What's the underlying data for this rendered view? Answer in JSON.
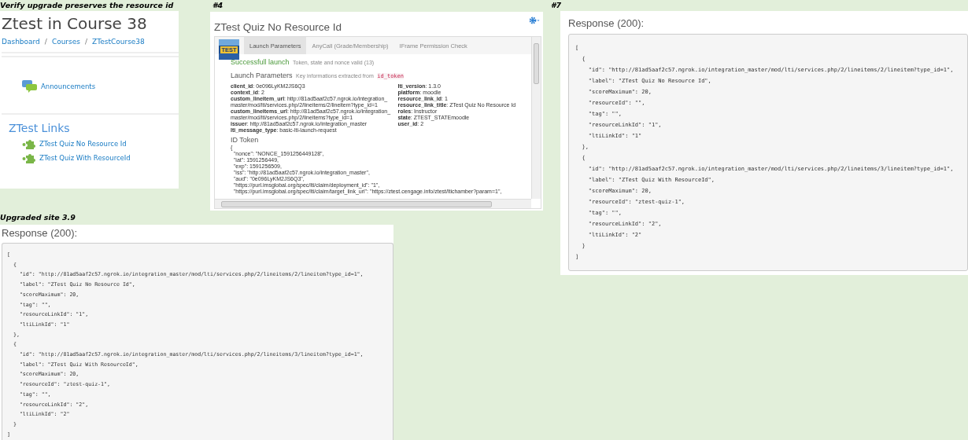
{
  "course_page": {
    "caption": "Verify upgrade preserves the resource id",
    "title": "Ztest in Course 38",
    "breadcrumbs": [
      "Dashboard",
      "Courses",
      "ZTestCourse38"
    ],
    "breadcrumb_separator": "/",
    "activities": [
      {
        "label": "Announcements"
      }
    ],
    "section_title": "ZTest Links",
    "links": [
      {
        "label": "ZTest Quiz No Resource Id"
      },
      {
        "label": "ZTest Quiz With ResourceId"
      }
    ]
  },
  "tool_page": {
    "caption": "#4",
    "title": "ZTest Quiz No Resource Id",
    "logo_text": "TEST",
    "tabs": [
      {
        "label": "Launch Parameters",
        "selected": true
      },
      {
        "label": "AnyCall (Grade/Membership)",
        "selected": false
      },
      {
        "label": "IFrame Permission Check",
        "selected": false
      }
    ],
    "status_title": "Successfull launch",
    "status_note": "Token, state and nonce valid (13)",
    "params_heading": "Launch Parameters",
    "params_note": "Key informations extracted from",
    "params_code": "id_token",
    "params_left": [
      "**client_id**: 0e096LyKM2JS6Q3",
      "**context_id**: 2",
      "**custom_lineitem_url**: http://81ad5aaf2c57.ngrok.io/integration_master/mod/lti/services.php/2/lineitems/2/lineitem?type_id=1",
      "**custom_lineitems_url**: http://81ad5aaf2c57.ngrok.io/integration_master/mod/lti/services.php/2/lineitems?type_id=1",
      "**issuer**: http://81ad5aaf2c57.ngrok.io/integration_master",
      "**lti_message_type**: basic-lti-launch-request"
    ],
    "params_right": [
      "**lti_version**: 1.3.0",
      "**platform**: moodle",
      "**resource_link_id**: 1",
      "**resource_link_title**: ZTest Quiz No Resource Id",
      "**roles**: Instructor",
      "**state**: ZTEST_STATEmoodle",
      "**user_id**: 2"
    ],
    "token_heading": "ID Token",
    "token_lines": [
      "{",
      "  \"nonce\": \"NONCE_1591256449128\",",
      "  \"iat\": 1591256449,",
      "  \"exp\": 1591256509,",
      "  \"iss\": \"http://81ad5aaf2c57.ngrok.io/integration_master\",",
      "  \"aud\": \"0e096LyKM2JS6Q3\",",
      "  \"https://purl.imsglobal.org/spec/lti/claim/deployment_id\": \"1\",",
      "  \"https://purl.imsglobal.org/spec/lti/claim/target_link_uri\": \"https://ztest.cengage.info/ztest/ltichamber?param=1\","
    ]
  },
  "responses": [
    {
      "caption": "#7",
      "title": "Response (200):",
      "lines": [
        "[",
        "  {",
        "    \"id\": \"http://81ad5aaf2c57.ngrok.io/integration_master/mod/lti/services.php/2/lineitems/2/lineitem?type_id=1\",",
        "    \"label\": \"ZTest Quiz No Resource Id\",",
        "    \"scoreMaximum\": 20,",
        "    \"resourceId\": \"\",",
        "    \"tag\": \"\",",
        "    \"resourceLinkId\": \"1\",",
        "    \"ltiLinkId\": \"1\"",
        "  },",
        "  {",
        "    \"id\": \"http://81ad5aaf2c57.ngrok.io/integration_master/mod/lti/services.php/2/lineitems/3/lineitem?type_id=1\",",
        "    \"label\": \"ZTest Quiz With ResourceId\",",
        "    \"scoreMaximum\": 20,",
        "    \"resourceId\": \"ztest-quiz-1\",",
        "    \"tag\": \"\",",
        "    \"resourceLinkId\": \"2\",",
        "    \"ltiLinkId\": \"2\"",
        "  }",
        "]"
      ]
    },
    {
      "caption": "Upgraded site 3.9",
      "title": "Response (200):",
      "lines": [
        "[",
        "  {",
        "    \"id\": \"http://81ad5aaf2c57.ngrok.io/integration_master/mod/lti/services.php/2/lineitems/2/lineitem?type_id=1\",",
        "    \"label\": \"ZTest Quiz No Resource Id\",",
        "    \"scoreMaximum\": 20,",
        "    \"tag\": \"\",",
        "    \"resourceLinkId\": \"1\",",
        "    \"ltiLinkId\": \"1\"",
        "  },",
        "  {",
        "    \"id\": \"http://81ad5aaf2c57.ngrok.io/integration_master/mod/lti/services.php/2/lineitems/3/lineitem?type_id=1\",",
        "    \"label\": \"ZTest Quiz With ResourceId\",",
        "    \"scoreMaximum\": 20,",
        "    \"resourceId\": \"ztest-quiz-1\",",
        "    \"tag\": \"\",",
        "    \"resourceLinkId\": \"2\",",
        "    \"ltiLinkId\": \"2\"",
        "  }",
        "]"
      ]
    }
  ]
}
